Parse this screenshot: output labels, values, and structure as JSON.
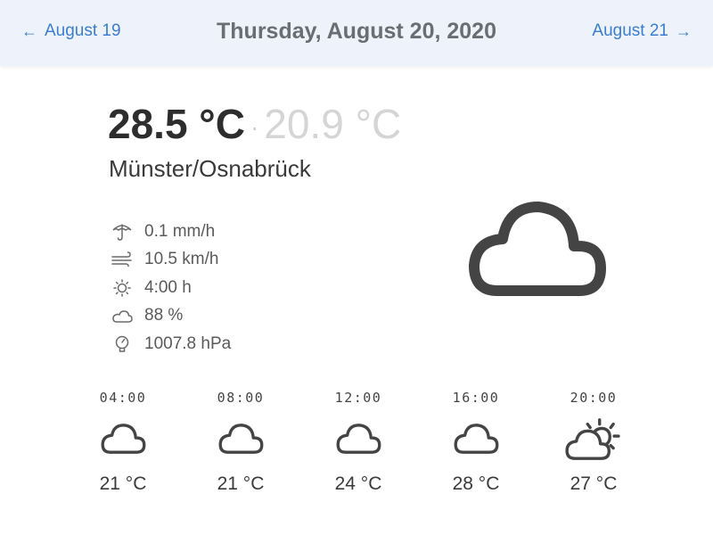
{
  "header": {
    "prev_label": "August 19",
    "prev_arrow": "←",
    "title": "Thursday, August 20, 2020",
    "next_label": "August 21",
    "next_arrow": "→"
  },
  "current": {
    "temp_max": "28.5 °C",
    "separator": "·",
    "temp_min": "20.9 °C",
    "location": "Münster/Osnabrück",
    "condition_icon": "cloud-icon"
  },
  "stats": [
    {
      "icon": "umbrella-icon",
      "value": "0.1 mm/h"
    },
    {
      "icon": "wind-icon",
      "value": "10.5 km/h"
    },
    {
      "icon": "sun-icon",
      "value": "4:00 h"
    },
    {
      "icon": "cloud-icon",
      "value": "88 %"
    },
    {
      "icon": "pressure-icon",
      "value": "1007.8 hPa"
    }
  ],
  "hourly": [
    {
      "time": "04:00",
      "icon": "cloud-icon",
      "temp": "21 °C"
    },
    {
      "time": "08:00",
      "icon": "cloud-icon",
      "temp": "21 °C"
    },
    {
      "time": "12:00",
      "icon": "cloud-icon",
      "temp": "24 °C"
    },
    {
      "time": "16:00",
      "icon": "cloud-icon",
      "temp": "28 °C"
    },
    {
      "time": "20:00",
      "icon": "partly-sunny-icon",
      "temp": "27 °C"
    }
  ],
  "colors": {
    "header_bg": "#eef3fb",
    "link": "#3a7dd1",
    "title": "#6a6d72",
    "icon": "#444444"
  }
}
